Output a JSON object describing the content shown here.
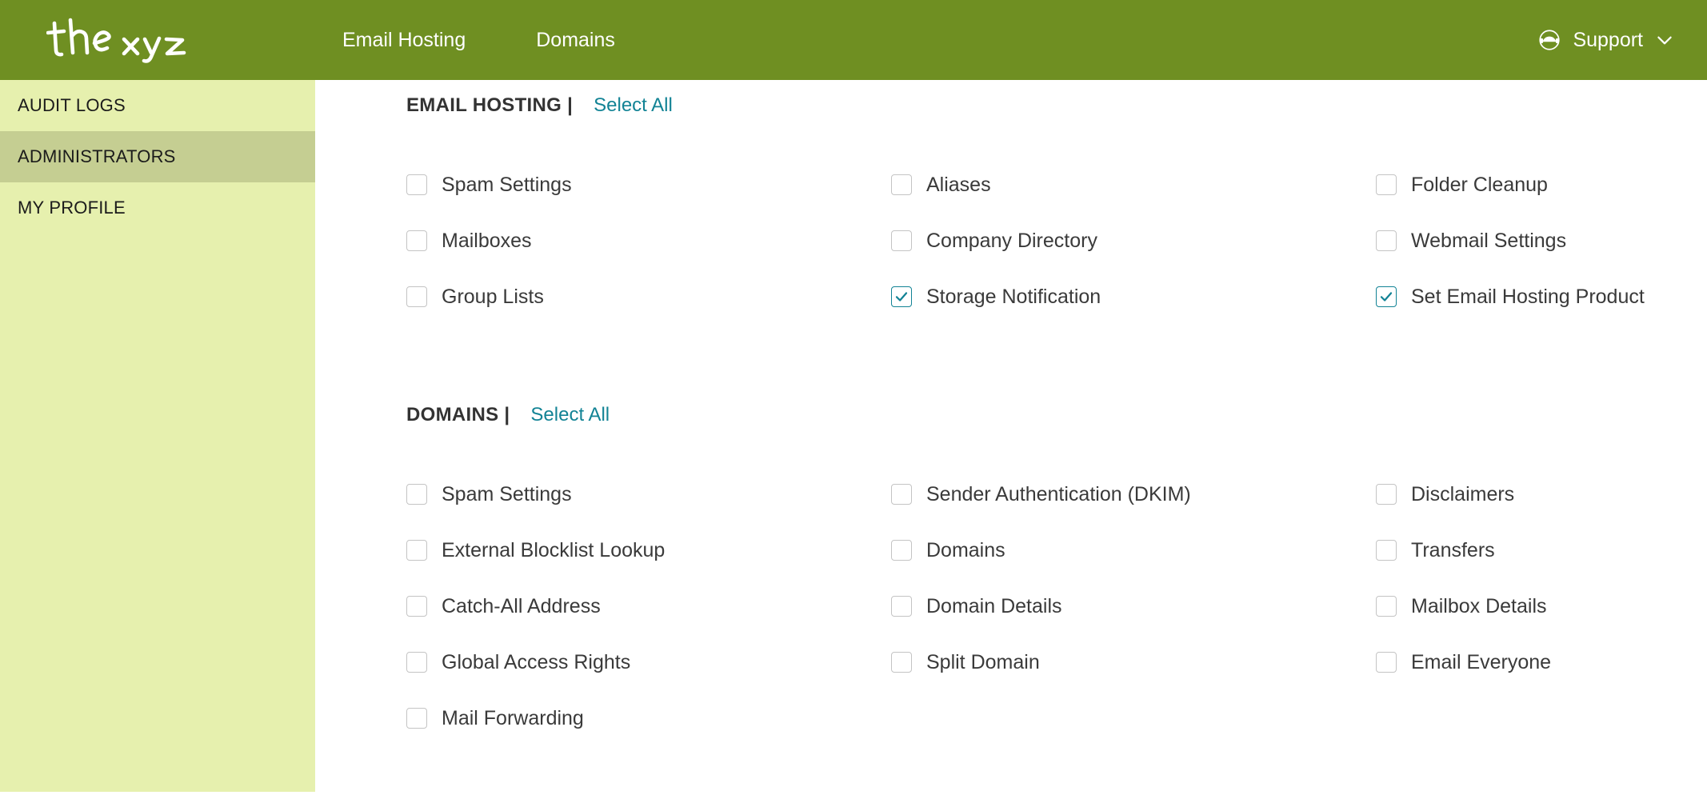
{
  "colors": {
    "header_green": "#6F8F22",
    "sidebar_bg": "#E6F0AE",
    "sidebar_active": "#C5CE92",
    "accent_teal": "#128395",
    "text_dark": "#3a3a3a"
  },
  "header": {
    "logo_text": "thexyz",
    "nav": [
      {
        "label": "Email Hosting"
      },
      {
        "label": "Domains"
      }
    ],
    "support": {
      "icon": "support-agent-icon",
      "label": "Support",
      "chevron": "chevron-down-icon"
    }
  },
  "sidebar": {
    "items": [
      {
        "label": "AUDIT LOGS",
        "active": false
      },
      {
        "label": "ADMINISTRATORS",
        "active": true
      },
      {
        "label": "MY PROFILE",
        "active": false
      }
    ]
  },
  "main": {
    "sections": [
      {
        "key": "email_hosting",
        "title": "EMAIL HOSTING |",
        "select_all": "Select All",
        "columns": [
          [
            {
              "label": "Spam Settings",
              "checked": false
            },
            {
              "label": "Mailboxes",
              "checked": false
            },
            {
              "label": "Group Lists",
              "checked": false
            }
          ],
          [
            {
              "label": "Aliases",
              "checked": false
            },
            {
              "label": "Company Directory",
              "checked": false
            },
            {
              "label": "Storage Notification",
              "checked": true
            }
          ],
          [
            {
              "label": "Folder Cleanup",
              "checked": false
            },
            {
              "label": "Webmail Settings",
              "checked": false
            },
            {
              "label": "Set Email Hosting Product",
              "checked": true
            }
          ]
        ]
      },
      {
        "key": "domains",
        "title": "DOMAINS |",
        "select_all": "Select All",
        "columns": [
          [
            {
              "label": "Spam Settings",
              "checked": false
            },
            {
              "label": "External Blocklist Lookup",
              "checked": false
            },
            {
              "label": "Catch-All Address",
              "checked": false
            },
            {
              "label": "Global Access Rights",
              "checked": false
            },
            {
              "label": "Mail Forwarding",
              "checked": false
            }
          ],
          [
            {
              "label": "Sender Authentication (DKIM)",
              "checked": false
            },
            {
              "label": "Domains",
              "checked": false
            },
            {
              "label": "Domain Details",
              "checked": false
            },
            {
              "label": "Split Domain",
              "checked": false
            }
          ],
          [
            {
              "label": "Disclaimers",
              "checked": false
            },
            {
              "label": "Transfers",
              "checked": false
            },
            {
              "label": "Mailbox Details",
              "checked": false
            },
            {
              "label": "Email Everyone",
              "checked": false
            }
          ]
        ]
      }
    ]
  }
}
